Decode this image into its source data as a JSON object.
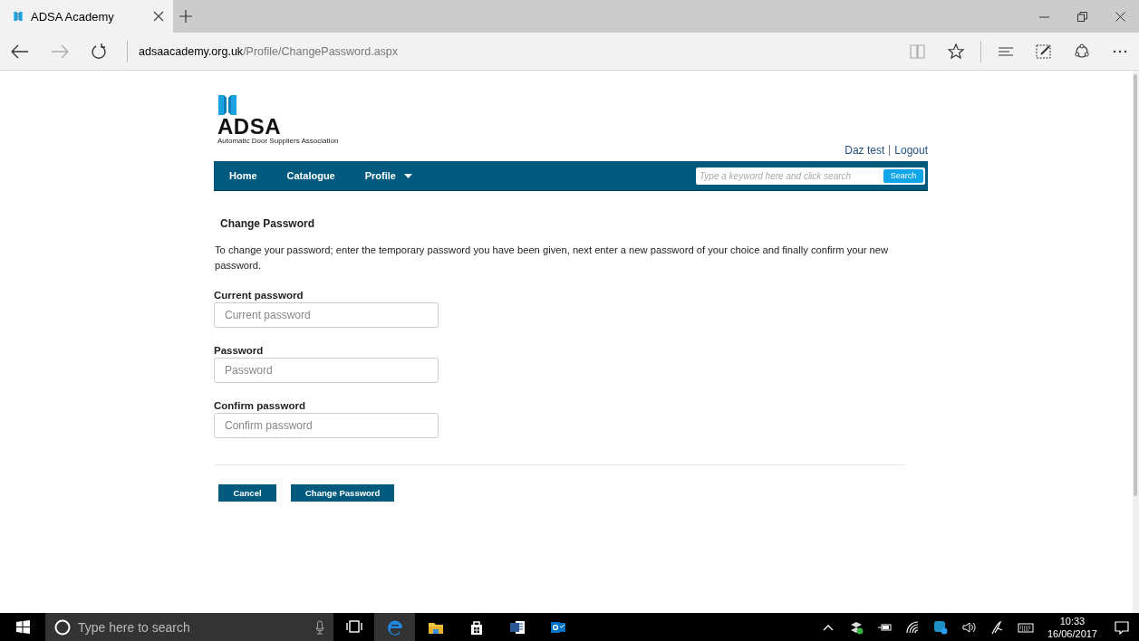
{
  "browser": {
    "tab_title": "ADSA Academy",
    "url_host": "adsaacademy.org.uk",
    "url_path": "/Profile/ChangePassword.aspx"
  },
  "site": {
    "logo_text": "ADSA",
    "logo_tagline": "Automatic Door Suppliers Association",
    "user_links": [
      {
        "label": "Daz test"
      },
      {
        "label": "Logout"
      }
    ],
    "nav": [
      {
        "label": "Home",
        "has_menu": false
      },
      {
        "label": "Catalogue",
        "has_menu": false
      },
      {
        "label": "Profile",
        "has_menu": true
      }
    ],
    "search": {
      "placeholder": "Type a keyword here and click search",
      "button": "Search"
    }
  },
  "form": {
    "heading": "Change Password",
    "intro": "To change your password; enter the temporary password you have been given, next enter a new password of your choice and finally confirm your new password.",
    "fields": [
      {
        "label": "Current password",
        "placeholder": "Current password"
      },
      {
        "label": "Password",
        "placeholder": "Password"
      },
      {
        "label": "Confirm password",
        "placeholder": "Confirm password"
      }
    ],
    "buttons": [
      "Cancel",
      "Change Password"
    ]
  },
  "taskbar": {
    "search_placeholder": "Type here to search",
    "time": "10:33",
    "date": "16/06/2017"
  }
}
